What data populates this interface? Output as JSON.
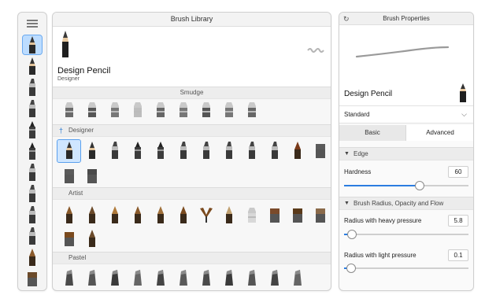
{
  "library": {
    "title": "Brush Library",
    "featured": {
      "name": "Design Pencil",
      "subtitle": "Designer"
    },
    "sections": [
      {
        "label": "Smudge",
        "count": 9
      },
      {
        "label": "Designer",
        "count": 13
      },
      {
        "label": "Artist",
        "count": 13
      },
      {
        "label": "Pastel",
        "count": 11
      }
    ]
  },
  "properties": {
    "title": "Brush Properties",
    "brush_name": "Design Pencil",
    "preset": "Standard",
    "tabs": [
      "Basic",
      "Advanced"
    ],
    "active_tab": "Advanced",
    "edge_section": "Edge",
    "hardness": {
      "label": "Hardness",
      "value": "60",
      "level": 0.6
    },
    "radius_section": "Brush Radius, Opacity and Flow",
    "heavy": {
      "label": "Radius with heavy pressure",
      "value": "5.8",
      "level": 0.058
    },
    "light": {
      "label": "Radius with light pressure",
      "value": "0.1",
      "level": 0.001
    }
  },
  "colors": {
    "accent": "#2b7de0",
    "selection": "#cfe6ff",
    "wood": "#8a5a2b"
  },
  "icons": {
    "menu": "hamburger-icon",
    "reset": "reset-icon",
    "pin": "pin-icon",
    "chevron": "chevron-down-icon",
    "triangle": "triangle-down-icon"
  }
}
